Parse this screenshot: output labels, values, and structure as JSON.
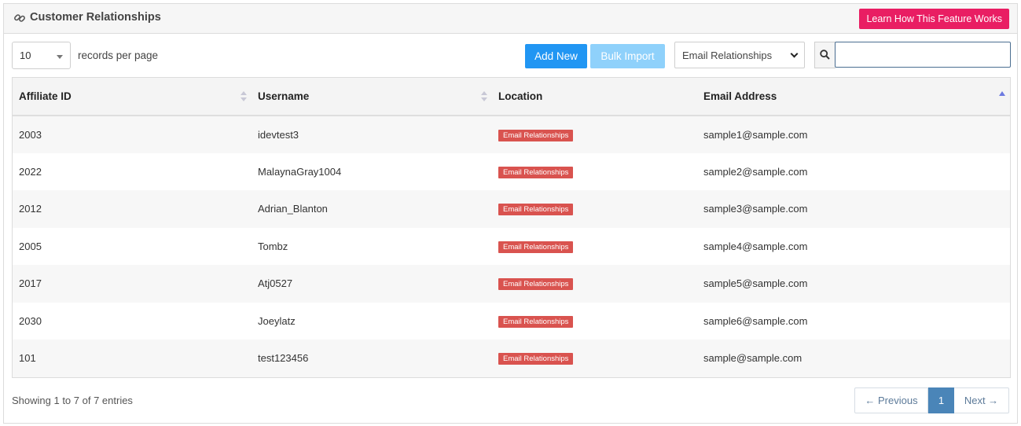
{
  "header": {
    "title": "Customer Relationships",
    "icon": "link-icon",
    "learn_button": "Learn How This Feature Works",
    "learn_button_color": "#e91e63"
  },
  "toolbar": {
    "records_per_page_value": "10",
    "records_per_page_label": "records per page",
    "add_new": "Add New",
    "bulk_import": "Bulk Import",
    "filter_value": "Email Relationships",
    "search_value": ""
  },
  "table": {
    "columns": [
      "Affiliate ID",
      "Username",
      "Location",
      "Email Address"
    ],
    "rows": [
      {
        "id": "2003",
        "username": "idevtest3",
        "location": "Email Relationships",
        "email": "sample1@sample.com"
      },
      {
        "id": "2022",
        "username": "MalaynaGray1004",
        "location": "Email Relationships",
        "email": "sample2@sample.com"
      },
      {
        "id": "2012",
        "username": "Adrian_Blanton",
        "location": "Email Relationships",
        "email": "sample3@sample.com"
      },
      {
        "id": "2005",
        "username": "Tombz",
        "location": "Email Relationships",
        "email": "sample4@sample.com"
      },
      {
        "id": "2017",
        "username": "Atj0527",
        "location": "Email Relationships",
        "email": "sample5@sample.com"
      },
      {
        "id": "2030",
        "username": "Joeylatz",
        "location": "Email Relationships",
        "email": "sample6@sample.com"
      },
      {
        "id": "101",
        "username": "test123456",
        "location": "Email Relationships",
        "email": "sample@sample.com"
      }
    ]
  },
  "footer": {
    "info": "Showing 1 to 7 of 7 entries",
    "previous": "← Previous",
    "current_page": "1",
    "next": "Next →"
  },
  "colors": {
    "primary": "#2196f3",
    "primary_light": "#8fd1fb",
    "badge": "#d9534f",
    "page_active": "#4a85b8"
  }
}
